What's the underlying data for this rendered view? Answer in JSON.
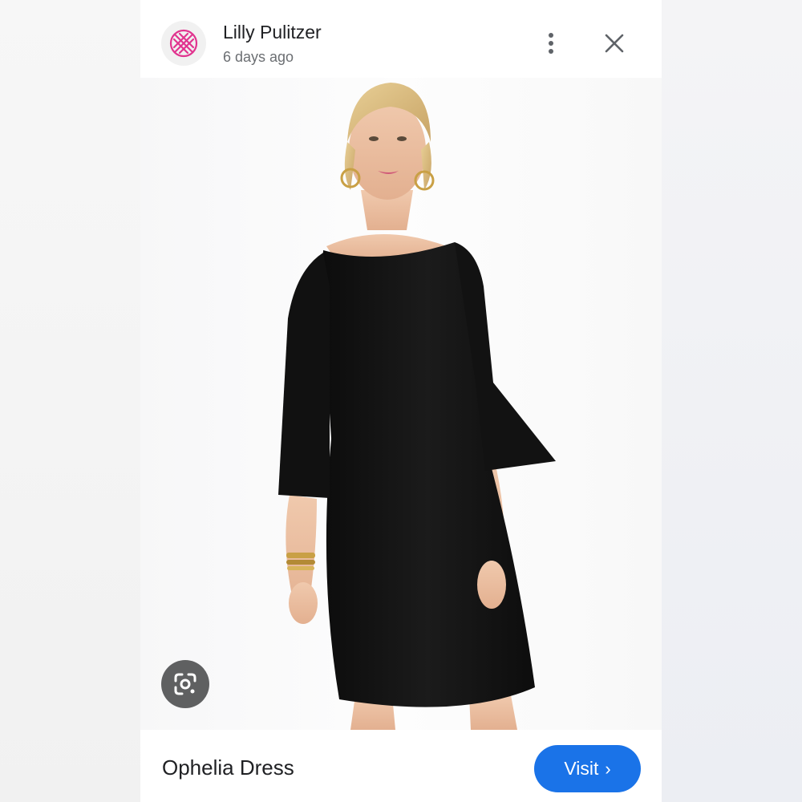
{
  "header": {
    "source_name": "Lilly Pulitzer",
    "timestamp": "6 days ago",
    "logo_icon": "lilly-pulitzer-logo",
    "more_icon": "more-vertical-icon",
    "close_icon": "close-icon"
  },
  "image": {
    "alt": "Woman wearing black dress with bell sleeves",
    "lens_icon": "google-lens-icon"
  },
  "footer": {
    "product_title": "Ophelia Dress",
    "visit_label": "Visit",
    "visit_chevron": "›"
  },
  "colors": {
    "brand_pink": "#e1348f",
    "visit_blue": "#1a73e8",
    "text_primary": "#202124",
    "text_secondary": "#6b6e72"
  }
}
